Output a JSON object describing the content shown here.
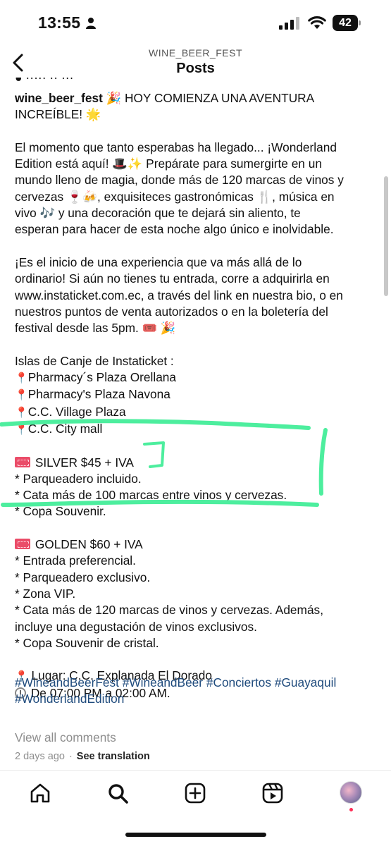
{
  "status_bar": {
    "time": "13:55",
    "battery": "42"
  },
  "header": {
    "account": "WINE_BEER_FEST",
    "title": "Posts"
  },
  "caption": {
    "username": "wine_beer_fest",
    "intro_1": " 🎉 HOY COMIENZA UNA AVENTURA",
    "intro_2": "INCREÍBLE! 🌟",
    "p1_l1": "El momento que tanto esperabas ha llegado... ¡Wonderland",
    "p1_l2": "Edition está aquí! 🎩✨ Prepárate para sumergirte en un",
    "p1_l3": "mundo lleno de magia, donde más de 120 marcas de vinos y",
    "p1_l4": "cervezas 🍷🍻, exquisiteces gastronómicas 🍴, música en",
    "p1_l5": "vivo 🎶 y una decoración que te dejará sin aliento, te",
    "p1_l6": "esperan para hacer de esta noche algo único e inolvidable.",
    "p2_l1": "¡Es el inicio de una experiencia que va más allá de lo",
    "p2_l2": "ordinario! Si aún no tienes tu entrada, corre a adquirirla en",
    "p2_l3": "www.instaticket.com.ec, a través del link en nuestra bio, o en",
    "p2_l4": "nuestros puntos de venta autorizados o en la boletería del",
    "p2_l5": "festival desde las 5pm. 🎟️ 🎉",
    "islas_title": "Islas de Canje de Instaticket :",
    "islas": [
      "Pharmacy´s Plaza Orellana",
      "Pharmacy's Plaza Navona",
      "C.C. Village Plaza",
      "C.C. City mall"
    ],
    "silver_title": "SILVER $45 + IVA",
    "silver_items": [
      "* Parqueadero incluido.",
      "* Cata más de 100 marcas entre vinos y cervezas.",
      "* Copa Souvenir."
    ],
    "golden_title": "GOLDEN $60 + IVA",
    "golden_items": [
      "* Entrada preferencial.",
      "* Parqueadero exclusivo.",
      "* Zona VIP.",
      "* Cata más de 120 marcas de vinos y cervezas. Además,",
      "incluye una degustación de vinos exclusivos.",
      "* Copa Souvenir de cristal."
    ],
    "lugar": "Lugar: C.C. Explanada El Dorado",
    "horario": "De 07:00 PM a 02:00 AM."
  },
  "hashtags": {
    "line1": "#WineandBeerFest #WineandBeer #Conciertos #Guayaquil",
    "line2": "#WonderlandEdition"
  },
  "view_comments": "View all comments",
  "timestamp": "2 days ago",
  "see_translation": "See translation",
  "nav": [
    "home-icon",
    "search-icon",
    "create-icon",
    "reels-icon",
    "profile-avatar"
  ],
  "colors": {
    "annotation": "#4dee9e",
    "hashtag": "#1e4a7c",
    "notification": "#ff2d55"
  }
}
